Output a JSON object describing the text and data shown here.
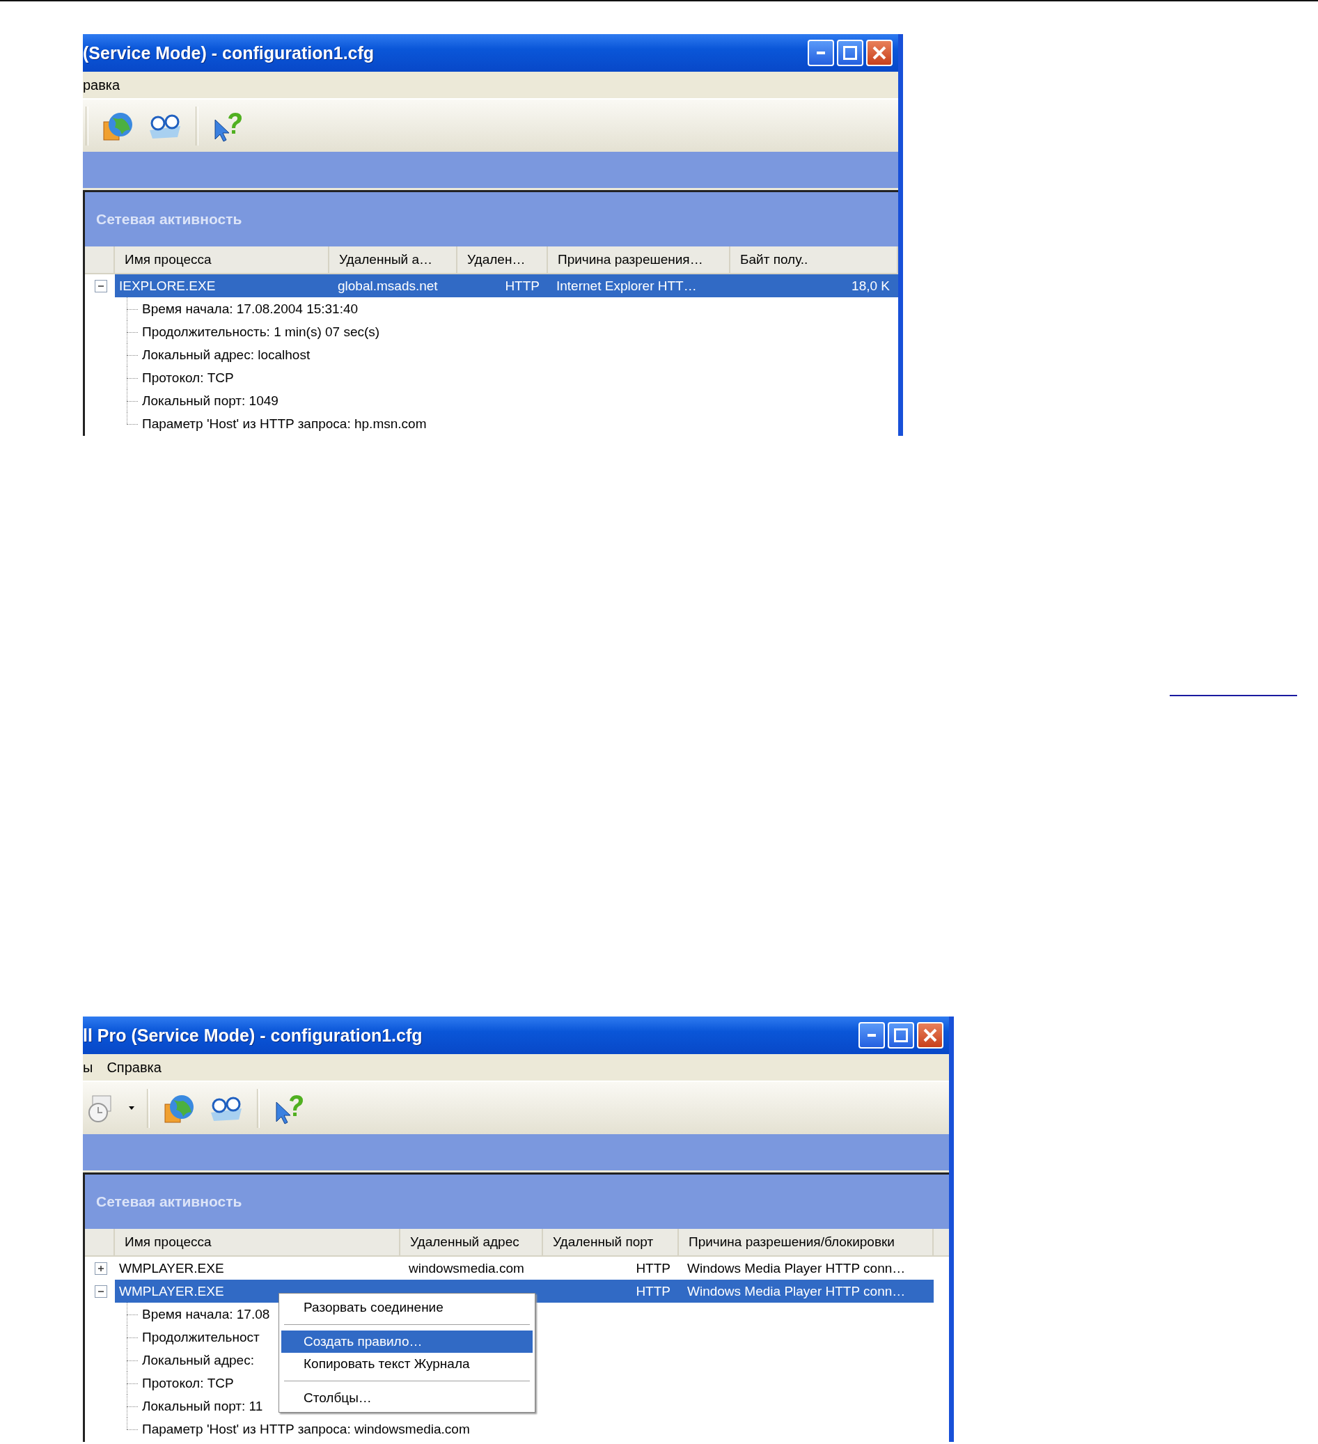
{
  "windows": [
    {
      "title": "(Service Mode) - configuration1.cfg",
      "menu": [
        "равка"
      ],
      "toolbar": [
        {
          "kind": "separator"
        },
        {
          "kind": "globe"
        },
        {
          "kind": "glasses"
        },
        {
          "kind": "separator"
        },
        {
          "kind": "help"
        }
      ],
      "panel_title": "Сетевая активность",
      "columns": [
        "Имя процесса",
        "Удаленный а…",
        "Удален…",
        "Причина разрешения…",
        "Байт полу.."
      ],
      "rows": [
        {
          "cells": [
            "IEXPLORE.EXE",
            "global.msads.net",
            "HTTP",
            "Internet Explorer HTT…",
            "18,0 K"
          ],
          "expanded": true,
          "selected": true,
          "children": [
            "Время начала: 17.08.2004 15:31:40",
            "Продолжительность: 1 min(s) 07 sec(s)",
            "Локальный адрес: localhost",
            "Протокол: TCP",
            "Локальный порт: 1049",
            "Параметр 'Host' из HTTP запроса: hp.msn.com"
          ]
        }
      ]
    },
    {
      "title": "ll Pro (Service Mode) - configuration1.cfg",
      "menu": [
        "ы",
        "Справка"
      ],
      "toolbar": [
        {
          "kind": "history"
        },
        {
          "kind": "dropdown"
        },
        {
          "kind": "separator"
        },
        {
          "kind": "globe"
        },
        {
          "kind": "glasses"
        },
        {
          "kind": "separator"
        },
        {
          "kind": "help"
        }
      ],
      "panel_title": "Сетевая активность",
      "columns": [
        "Имя процесса",
        "Удаленный адрес",
        "Удаленный порт",
        "Причина разрешения/блокировки"
      ],
      "rows": [
        {
          "cells": [
            "WMPLAYER.EXE",
            "windowsmedia.com",
            "HTTP",
            "Windows Media Player HTTP conn…"
          ],
          "expanded": false,
          "selected": false,
          "children": []
        },
        {
          "cells": [
            "WMPLAYER.EXE",
            null,
            "HTTP",
            "Windows Media Player HTTP conn…"
          ],
          "expanded": true,
          "selected": true,
          "children": [
            "Время начала: 17.08",
            "Продолжительност",
            "Локальный адрес:",
            "Протокол: TCP",
            "Локальный порт: 11",
            "Параметр 'Host' из HTTP запроса: windowsmedia.com"
          ]
        }
      ],
      "context_menu": [
        [
          {
            "label": "Разорвать соединение",
            "selected": false
          }
        ],
        [
          {
            "label": "Создать правило…",
            "selected": true
          },
          {
            "label": "Копировать текст Журнала",
            "selected": false
          }
        ],
        [
          {
            "label": "Столбцы…",
            "selected": false
          }
        ]
      ]
    }
  ]
}
